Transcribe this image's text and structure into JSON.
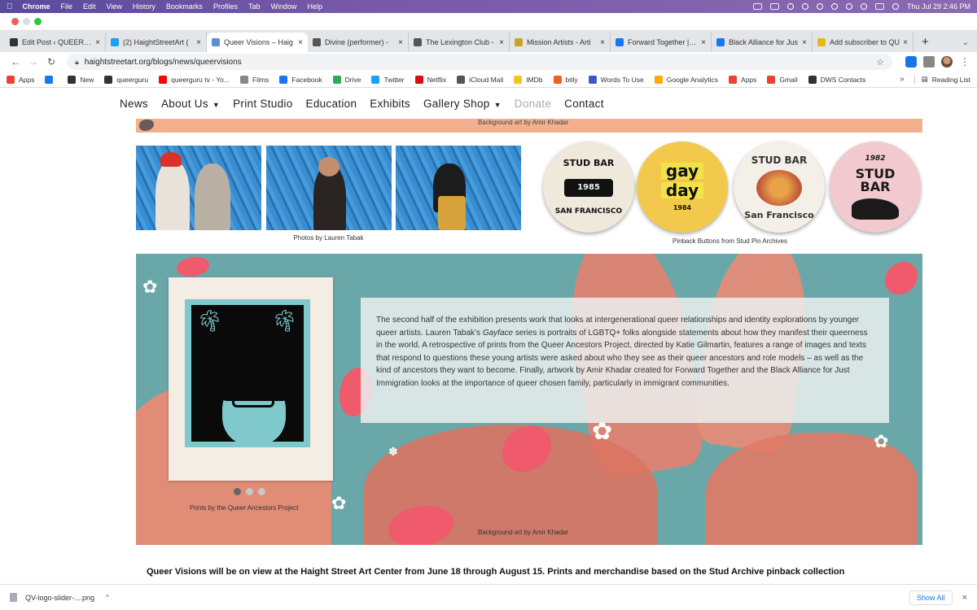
{
  "menubar": {
    "apple": "",
    "app": "Chrome",
    "items": [
      "File",
      "Edit",
      "View",
      "History",
      "Bookmarks",
      "Profiles",
      "Tab",
      "Window",
      "Help"
    ],
    "clock": "Thu Jul 29  2:46 PM"
  },
  "tabs": [
    {
      "title": "Edit Post ‹ QUEERGURU",
      "icon": "glasses-icon",
      "color": "#333333"
    },
    {
      "title": "(2) HaightStreetArt (",
      "icon": "twitter-icon",
      "color": "#1da1f2"
    },
    {
      "title": "Queer Visions – Haig",
      "icon": "site-icon",
      "color": "#5b8fd6",
      "active": true
    },
    {
      "title": "Divine (performer) - ",
      "icon": "wikipedia-icon",
      "color": "#555555"
    },
    {
      "title": "The Lexington Club - ",
      "icon": "wikipedia-icon",
      "color": "#555555"
    },
    {
      "title": "Mission Artists - Arti",
      "icon": "mission-icon",
      "color": "#c9a227"
    },
    {
      "title": "Forward Together | Fo",
      "icon": "facebook-icon",
      "color": "#1877f2"
    },
    {
      "title": "Black Alliance for Jus",
      "icon": "facebook-icon",
      "color": "#1877f2"
    },
    {
      "title": "Add subscriber to QU",
      "icon": "mailchimp-icon",
      "color": "#e8b81a"
    }
  ],
  "toolbar": {
    "url": "haightstreetart.org/blogs/news/queervisions"
  },
  "bookmarks": [
    {
      "label": "Apps",
      "color": "#ea4335"
    },
    {
      "label": "",
      "color": "#1877f2"
    },
    {
      "label": "New",
      "color": "#333333"
    },
    {
      "label": "queerguru",
      "color": "#333333"
    },
    {
      "label": "queerguru tv - Yo...",
      "color": "#ff0000"
    },
    {
      "label": "Films",
      "color": "#888888"
    },
    {
      "label": "Facebook",
      "color": "#1877f2"
    },
    {
      "label": "Drive",
      "color": "#34a853"
    },
    {
      "label": "Twitter",
      "color": "#1da1f2"
    },
    {
      "label": "Netflix",
      "color": "#e50914"
    },
    {
      "label": "iCloud Mail",
      "color": "#555555"
    },
    {
      "label": "IMDb",
      "color": "#f5c518"
    },
    {
      "label": "bitly",
      "color": "#ee6123"
    },
    {
      "label": "Words To Use",
      "color": "#3a5bc7"
    },
    {
      "label": "Google Analytics",
      "color": "#f9ab00"
    },
    {
      "label": "Apps",
      "color": "#ea4335"
    },
    {
      "label": "Gmail",
      "color": "#ea4335"
    },
    {
      "label": "DWS Contacts",
      "color": "#333333"
    }
  ],
  "bookmarks_more": "»",
  "reading_list": "Reading List",
  "site_nav": {
    "news": "News",
    "about": "About Us",
    "print_studio": "Print Studio",
    "education": "Education",
    "exhibits": "Exhibits",
    "gallery_shop": "Gallery Shop",
    "donate": "Donate",
    "contact": "Contact"
  },
  "captions": {
    "background_top": "Background art by Amir Khadar",
    "photos": "Photos by Lauren Tabak",
    "buttons": "Pinback Buttons from Stud Pin Archives",
    "prints": "Prints by the Queer Ancestors Project",
    "background_bottom": "Background art by Amir Khadar"
  },
  "pin_buttons": [
    {
      "line1": "STUD BAR",
      "line2": "1985",
      "line3": "SAN FRANCISCO",
      "bg": "#efe9dc",
      "fg": "#111111"
    },
    {
      "line1": "gay",
      "line2": "day",
      "line3": "1984",
      "bg": "#f2c94c",
      "fg": "#111111"
    },
    {
      "line1": "STUD BAR",
      "line2": "",
      "line3": "San Francisco",
      "bg": "#f4f0e8",
      "fg": "#333333"
    },
    {
      "line1": "1982",
      "line2": "STUD",
      "line3": "BAR",
      "bg": "#f1c9cf",
      "fg": "#1a1a1a"
    }
  ],
  "feature_text": {
    "part1": "The second half of the exhibition presents work that looks at intergenerational queer relationships and identity explorations by younger queer artists. Lauren Tabak’s ",
    "italic": "Gayface",
    "part2": " series is portraits of LGBTQ+ folks alongside statements about how they manifest their queerness in the world. A retrospective of prints from the Queer Ancestors Project, directed by Katie Gilmartin, features a range of images and texts that respond to questions these young artists were asked about who they see as their queer ancestors and role models – as well as the kind of ancestors they want to become. Finally, artwork by Amir Khadar created for Forward Together and the Black Alliance for Just Immigration looks at the importance of queer chosen family, particularly in immigrant communities."
  },
  "carousel": {
    "count": 3,
    "active": 1
  },
  "bottom_text": "Queer Visions will be on view at the Haight Street Art Center from June 18 through August 15. Prints and merchandise based on the Stud Archive pinback collection",
  "downloads": {
    "file": "QV-logo-slider-....png",
    "show_all": "Show All"
  }
}
